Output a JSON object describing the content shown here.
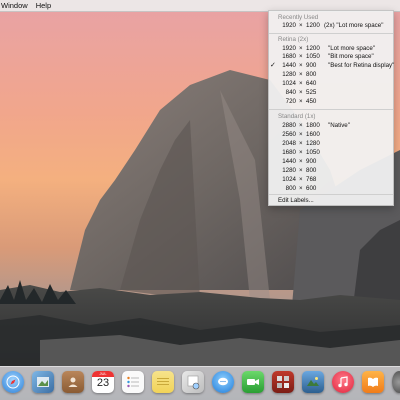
{
  "menubar": {
    "items": [
      "Window",
      "Help"
    ]
  },
  "resolution_menu": {
    "recently_used_header": "Recently Used",
    "recently_used": [
      {
        "w": "1920",
        "h": "1200",
        "note": "(2x)  \"Lot more space\""
      }
    ],
    "retina_header": "Retina (2x)",
    "retina": [
      {
        "w": "1920",
        "h": "1200",
        "note": "\"Lot more space\"",
        "checked": false
      },
      {
        "w": "1680",
        "h": "1050",
        "note": "\"Bit more space\"",
        "checked": false
      },
      {
        "w": "1440",
        "h": "900",
        "note": "\"Best for Retina display\"",
        "checked": true
      },
      {
        "w": "1280",
        "h": "800",
        "note": "",
        "checked": false
      },
      {
        "w": "1024",
        "h": "640",
        "note": "",
        "checked": false
      },
      {
        "w": "840",
        "h": "525",
        "note": "",
        "checked": false
      },
      {
        "w": "720",
        "h": "450",
        "note": "",
        "checked": false
      }
    ],
    "standard_header": "Standard (1x)",
    "standard": [
      {
        "w": "2880",
        "h": "1800",
        "note": "\"Native\""
      },
      {
        "w": "2560",
        "h": "1600",
        "note": ""
      },
      {
        "w": "2048",
        "h": "1280",
        "note": ""
      },
      {
        "w": "1680",
        "h": "1050",
        "note": ""
      },
      {
        "w": "1440",
        "h": "900",
        "note": ""
      },
      {
        "w": "1280",
        "h": "800",
        "note": ""
      },
      {
        "w": "1024",
        "h": "768",
        "note": ""
      },
      {
        "w": "800",
        "h": "600",
        "note": ""
      }
    ],
    "separator_x": "×",
    "check_mark": "✓",
    "edit_labels": "Edit Labels..."
  },
  "dock": {
    "calendar_month": "JUL",
    "calendar_day": "23",
    "icons": [
      "safari-icon",
      "preview-icon",
      "contacts-icon",
      "calendar-icon",
      "reminders-icon",
      "notes-icon",
      "photo-viewer-icon",
      "messages-icon",
      "facetime-icon",
      "photo-booth-icon",
      "iphoto-icon",
      "music-icon",
      "ibooks-icon",
      "system-preferences-icon"
    ]
  }
}
